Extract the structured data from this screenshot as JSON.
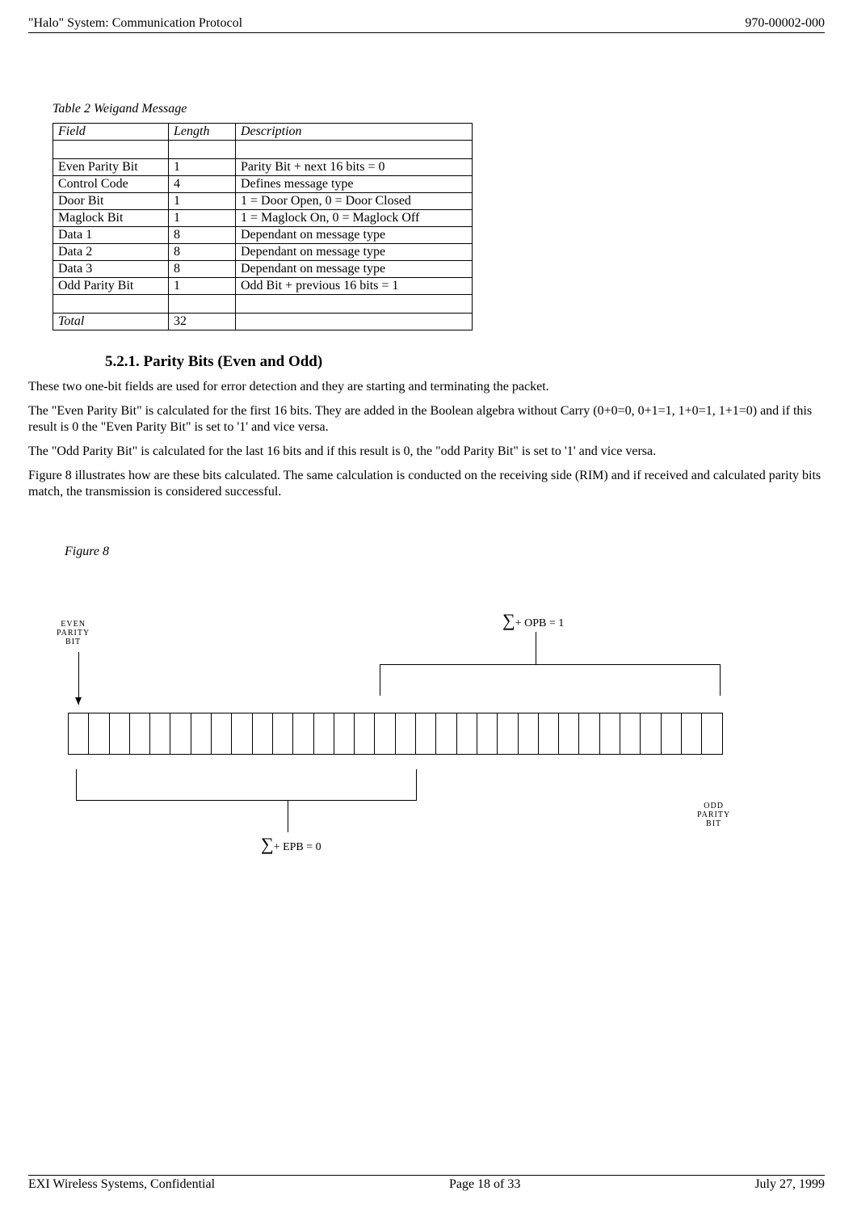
{
  "header": {
    "left": "\"Halo\" System: Communication Protocol",
    "right": "970-00002-000"
  },
  "table_caption": "Table 2    Weigand Message",
  "table_headers": {
    "field": "Field",
    "length": "Length",
    "description": "Description"
  },
  "table_rows": [
    {
      "field": "Even Parity Bit",
      "length": "1",
      "description": "Parity Bit + next 16 bits = 0"
    },
    {
      "field": "Control Code",
      "length": "4",
      "description": "Defines message type"
    },
    {
      "field": "Door Bit",
      "length": "1",
      "description": "1 = Door Open, 0 = Door Closed"
    },
    {
      "field": "Maglock Bit",
      "length": "1",
      "description": "1 = Maglock On, 0 = Maglock Off"
    },
    {
      "field": "Data 1",
      "length": "8",
      "description": "Dependant on message type"
    },
    {
      "field": "Data 2",
      "length": "8",
      "description": "Dependant on message type"
    },
    {
      "field": "Data 3",
      "length": "8",
      "description": "Dependant on message type"
    },
    {
      "field": "Odd Parity Bit",
      "length": "1",
      "description": "Odd Bit + previous 16 bits = 1"
    }
  ],
  "table_total": {
    "label": "Total",
    "value": "32"
  },
  "section": {
    "heading": "5.2.1.  Parity Bits (Even and Odd)",
    "p1": "These two one-bit fields are used for error detection and they are starting and terminating the packet.",
    "p2": "The \"Even Parity Bit\" is calculated for the first 16 bits. They are added in the Boolean algebra without Carry (0+0=0, 0+1=1, 1+0=1, 1+1=0) and if this result is 0 the \"Even Parity Bit\" is set to '1' and vice versa.",
    "p3": "The \"Odd Parity Bit\" is calculated for the last 16 bits and if this result is 0, the \"odd Parity Bit\" is set to '1' and vice versa.",
    "p4": "Figure 8 illustrates how are these bits calculated. The same calculation is conducted on the receiving side (RIM) and if received and calculated parity bits match, the transmission is considered successful."
  },
  "figure_caption": "Figure 8",
  "figure": {
    "even_label": "EVEN\nPARITY\nBIT",
    "odd_label": "ODD\nPARITY\nBIT",
    "sum_top": "+ OPB = 1",
    "sum_bot": "+ EPB = 0",
    "bit_count": 32
  },
  "footer": {
    "left": "EXI Wireless Systems, Confidential",
    "center": "Page 18 of 33",
    "right": "July 27, 1999"
  }
}
